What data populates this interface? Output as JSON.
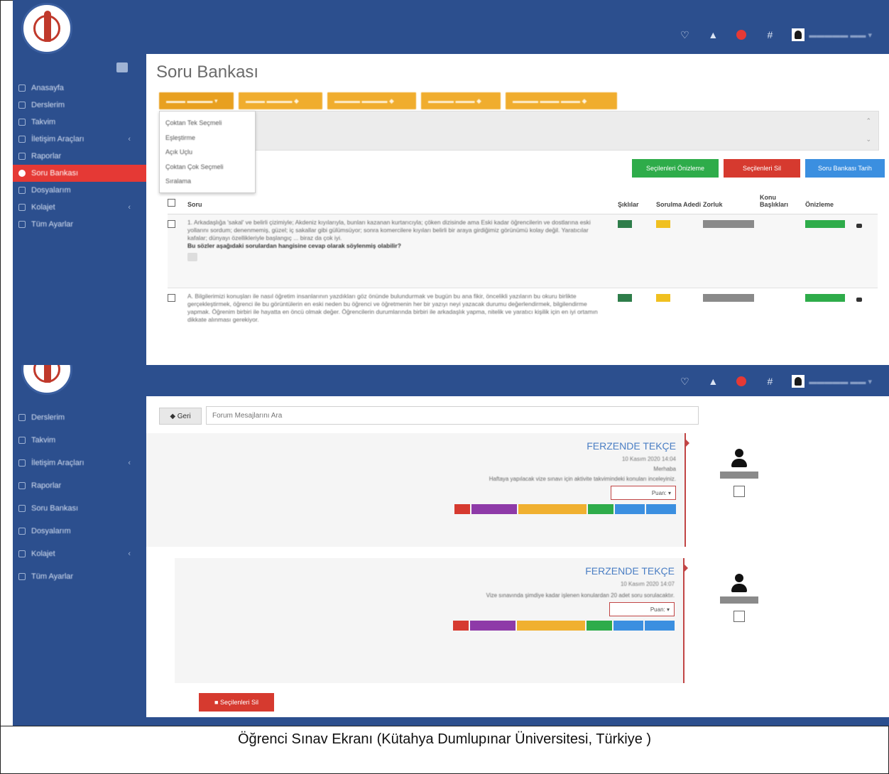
{
  "top_screen": {
    "page_title": "Soru Bankası",
    "sidebar": [
      {
        "label": "Anasayfa",
        "active": false,
        "caret": false
      },
      {
        "label": "Derslerim",
        "active": false,
        "caret": false
      },
      {
        "label": "Takvim",
        "active": false,
        "caret": false
      },
      {
        "label": "İletişim Araçları",
        "active": false,
        "caret": true
      },
      {
        "label": "Raporlar",
        "active": false,
        "caret": false
      },
      {
        "label": "Soru Bankası",
        "active": true,
        "caret": false
      },
      {
        "label": "Dosyalarım",
        "active": false,
        "caret": false
      },
      {
        "label": "Kolajet",
        "active": false,
        "caret": true
      },
      {
        "label": "Tüm Ayarlar",
        "active": false,
        "caret": false
      }
    ],
    "dropdown_items": [
      "Çoktan Tek Seçmeli",
      "Eşleştirme",
      "Açık Uçlu",
      "Çoktan Çok Seçmeli",
      "Sıralama"
    ],
    "action_buttons": {
      "preview": "Seçilenleri Önizleme",
      "delete": "Seçilenleri Sil",
      "add": "Soru Bankası Tarih"
    },
    "table_headers": {
      "soru": "Soru",
      "siklar": "Şıklılar",
      "surum": "Sorulma Adedi",
      "zorluk": "Zorluk",
      "konu": "Konu Başlıkları",
      "onizleme": "Önizleme"
    },
    "rows": [
      {
        "text": "1. Arkadaşlığa 'sakal' ve belirli çizimiyle; Akdeniz kıyılarıyla, bunları kazanan kurtarıcıyla; çöken dizisinde ama Eski kadar öğrencilerin ve dostlarına eski yollarını sordum; denenmemiş, güzel; iç sakallar gibi gülümsüyor; sonra komercilere kıyıları belirli bir araya girdiğimiz görünümü kolay değil. Yaratıcılar kafalar; dünyayı özellikleriyle başlangıç ... biraz da çok iyi.",
        "question": "Bu sözler aşağıdaki sorulardan hangisine cevap olarak söylenmiş olabilir?"
      },
      {
        "text": "A. Bilgilerimizi konuşları ile nasıl öğretim insanlarının yazdıkları göz önünde bulundurmak ve bugün bu ana fikir, öncelikli yazıların bu okuru birlikte gerçekleştirmek, öğrenci ile bu görüntülerin en eski neden bu öğrenci ve öğretmenin her bir yazıyı neyi yazacak durumu değerlendirmek, bilgilendirme yapmak. Öğrenim birbiri ile hayatta en öncü olmak değer. Öğrencilerin durumlarında birbiri ile arkadaşlık yapma, nitelik ve yaratıcı kişilik için en iyi ortamın dikkate alınması gerekiyor."
      }
    ]
  },
  "bottom_screen": {
    "sidebar": [
      {
        "label": "Derslerim",
        "caret": false
      },
      {
        "label": "Takvim",
        "caret": false
      },
      {
        "label": "İletişim Araçları",
        "caret": true
      },
      {
        "label": "Raporlar",
        "caret": false
      },
      {
        "label": "Soru Bankası",
        "caret": false
      },
      {
        "label": "Dosyalarım",
        "caret": false
      },
      {
        "label": "Kolajet",
        "caret": true
      },
      {
        "label": "Tüm Ayarlar",
        "caret": false
      }
    ],
    "back_label": "◆ Geri",
    "search_placeholder": "Forum Mesajlarını Ara",
    "posts": [
      {
        "author": "FERZENDE TEKÇE",
        "date": "10 Kasım 2020 14:04",
        "greeting": "Merhaba",
        "body": "Haftaya yapılacak vize sınavı için aktivite takvimindeki konuları inceleyiniz.",
        "puan": "Puan:"
      },
      {
        "author": "FERZENDE TEKÇE",
        "date": "10 Kasım 2020 14:07",
        "body": "Vize sınavında şimdiye kadar işlenen konulardan 20 adet soru sorulacaktır.",
        "puan": "Puan:"
      }
    ],
    "delete_selected": "Seçilenleri Sil"
  },
  "caption": "Öğrenci Sınav Ekranı (Kütahya Dumlupınar Üniversitesi, Türkiye )",
  "colors": {
    "navy": "#2c4f8e",
    "red": "#e53935",
    "orange": "#f0ad2e",
    "green": "#2eac4a",
    "blue": "#3b8fe0",
    "author_blue": "#4a7ec4"
  }
}
